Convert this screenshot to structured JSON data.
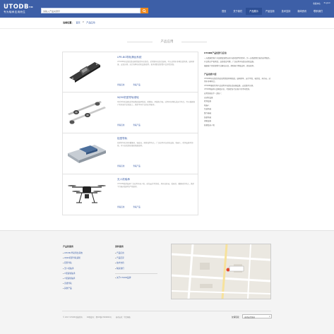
{
  "header": {
    "logo": "UTODB",
    "logo_tm": "TM",
    "slogan": "专为轴承应用而生",
    "search_placeholder": "请输入产品关键字",
    "top_links": [
      "收藏本站",
      "English"
    ],
    "nav": [
      {
        "label": "首页",
        "active": false
      },
      {
        "label": "关于我们",
        "active": false
      },
      {
        "label": "产品展示",
        "active": true
      },
      {
        "label": "产品应用",
        "active": false
      },
      {
        "label": "技术支持",
        "active": false
      },
      {
        "label": "新闻资讯",
        "active": false
      },
      {
        "label": "联系我们",
        "active": false
      }
    ]
  },
  "breadcrumb": {
    "label": "当前位置：",
    "items": [
      "首页",
      ">",
      "产品应用"
    ]
  },
  "page_title": "产品应用",
  "products": [
    {
      "title": "LPR-BG导轨滑台系统",
      "desc": "UTODB导轨滑台是高刚性线性导轨滑台，采用双导轨组合结构，可以适用于多种负载场景，结构紧凑、安装方便，适合各种自动化设备使用，更多参数请查看产品详情页面。",
      "links": [
        "查看应用",
        "查看产品"
      ],
      "icon": "linear-rail-icon"
    },
    {
      "title": "WJ90机型导轨滚轮",
      "desc": "本系列导轨滚轮采用高精度轴承制造，耐磨损，承载能力强，适用于各种轨道运行场合，可以根据客户需求进行定制加工，满足不同行业的应用要求。",
      "links": [
        "查看应用",
        "查看产品"
      ],
      "icon": "roller-icon"
    },
    {
      "title": "铝型导轨",
      "desc": "铝型材导轨具有重量轻、强度高、耐腐蚀等特点，广泛应用于自动化设备、机器人、检测设备等领域，可与各类滑块滚轮搭配使用。",
      "links": [
        "查看应用",
        "查看产品"
      ],
      "icon": "aluminium-rail-icon"
    },
    {
      "title": "无人机轴承",
      "desc": "UTODB微型轴承广泛应用于无人机、航拍云台等领域，具有高转速、低噪音、重量轻的特点，满足飞行器对轴承的严格要求。",
      "links": [
        "查看应用",
        "查看产品"
      ],
      "icon": "drone-icon"
    }
  ],
  "side": {
    "intro_title": "UTODB产品优势与应用",
    "intro_paras": [
      "一方面满足客户对高精度线性运动与旋转部件的需求，另一方面提供完善的技术服务。",
      "产品经过严格测试，品质稳定可靠，广泛应用于各类自动化设备。",
      "根据客户需求提供专业解决方案，帮助客户降低成本、提高效率。"
    ],
    "range_title": "产品用途介绍",
    "range_paras": [
      "UTODB导轨滑台系统采用优质材料制造，结构简单、运行平稳、噪音低、寿命长，适用于多种场合。",
      "UTODB滚轮系列产品适用于各类轨道运输设备，安装维护方便。",
      "UTODB轴承产品种类齐全，可满足各行业客户的不同需求。"
    ],
    "apps_title": "应用领域如下（部分）：",
    "apps": [
      "自动化设备",
      "检测设备",
      "机器人",
      "包装机械",
      "医疗器械",
      "纺织机械",
      "印刷设备",
      "航模及无人机"
    ]
  },
  "footer": {
    "col1": {
      "title": "产品和服务",
      "items": [
        "LPR-BG导轨滑台系统",
        "WJ90机型导轨滚轮",
        "铝型导轨",
        "无人机轴承",
        "U型滚轮轴承",
        "V型滚轮轴承",
        "直线导轨",
        "其他产品"
      ]
    },
    "col2": {
      "title": "资料服务",
      "items": [
        "产品应用",
        "产品目录",
        "技术支持",
        "联系我们"
      ],
      "extra": "关于UTODB品牌"
    },
    "copyright": [
      "© 2017 UTODB 版权所有",
      "ICP备案号：粤ICP备17000000号",
      "技术支持：华企网络"
    ],
    "lang_label": "友情链接：",
    "lang_value": "选择友情链接"
  }
}
